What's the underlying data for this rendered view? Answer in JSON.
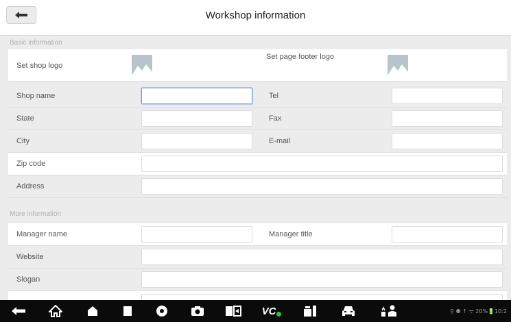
{
  "header": {
    "title": "Workshop information"
  },
  "sections": {
    "basic": "Basic information",
    "more": "More information"
  },
  "labels": {
    "shop_logo": "Set shop logo",
    "footer_logo": "Set page footer logo",
    "shop_name": "Shop name",
    "tel": "Tel",
    "state": "State",
    "fax": "Fax",
    "city": "City",
    "email": "E-mail",
    "zip": "Zip code",
    "address": "Address",
    "manager_name": "Manager name",
    "manager_title": "Manager title",
    "website": "Website",
    "slogan": "Slogan"
  },
  "fields": {
    "shop_name": "",
    "tel": "",
    "state": "",
    "fax": "",
    "city": "",
    "email": "",
    "zip": "",
    "address": "",
    "manager_name": "",
    "manager_title": "",
    "website": "",
    "slogan": ""
  },
  "navbar": {
    "icons": [
      "back-icon",
      "home-icon",
      "house-icon",
      "recent-apps-icon",
      "browser-icon",
      "camera-icon",
      "display-icon",
      "vci-icon",
      "tools-icon",
      "car-icon",
      "remote-icon"
    ],
    "vci_label": "VC",
    "status_text": "⚲ ⚉ ↑ ᯤ 20%🔋10:2"
  },
  "colors": {
    "navbar_bg": "#0b0b0b",
    "content_bg": "#ececec",
    "focus_border": "#7f9ed1",
    "vci_dot": "#3cc040"
  }
}
